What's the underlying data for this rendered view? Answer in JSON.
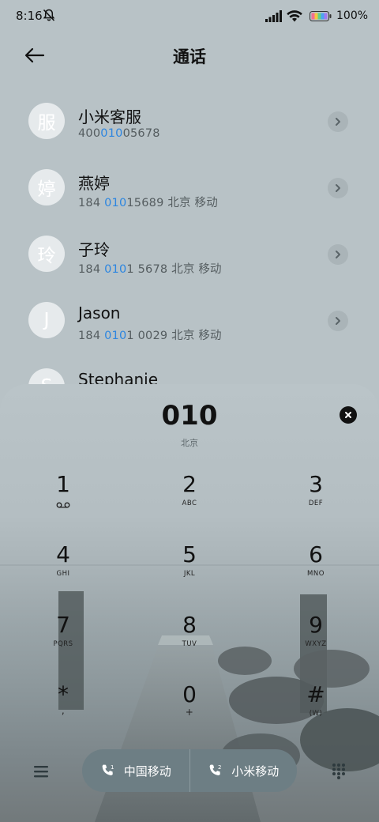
{
  "status": {
    "time": "8:16",
    "battery": "100%"
  },
  "header": {
    "title": "通话"
  },
  "contacts": [
    {
      "avatar": "服",
      "name": "小米客服",
      "number_pre": "400",
      "number_hl": "010",
      "number_post": "05678",
      "location": ""
    },
    {
      "avatar": "婷",
      "name": "燕婷",
      "number_pre": "184 ",
      "number_hl": "010",
      "number_post": "15689",
      "location": "北京 移动"
    },
    {
      "avatar": "玲",
      "name": "子玲",
      "number_pre": "184 ",
      "number_hl": "010",
      "number_post": "1 5678",
      "location": "北京 移动"
    },
    {
      "avatar": "J",
      "name": "Jason",
      "number_pre": "184 ",
      "number_hl": "010",
      "number_post": "1 0029",
      "location": "北京 移动"
    },
    {
      "avatar": "S",
      "name": "Stephanie",
      "number_pre": "",
      "number_hl": "",
      "number_post": "",
      "location": ""
    }
  ],
  "dialer": {
    "number": "010",
    "location": "北京",
    "keys": [
      {
        "digit": "1",
        "letters": ""
      },
      {
        "digit": "2",
        "letters": "ABC"
      },
      {
        "digit": "3",
        "letters": "DEF"
      },
      {
        "digit": "4",
        "letters": "GHI"
      },
      {
        "digit": "5",
        "letters": "JKL"
      },
      {
        "digit": "6",
        "letters": "MNO"
      },
      {
        "digit": "7",
        "letters": "PQRS"
      },
      {
        "digit": "8",
        "letters": "TUV"
      },
      {
        "digit": "9",
        "letters": "WXYZ"
      },
      {
        "digit": "*",
        "letters": ","
      },
      {
        "digit": "0",
        "letters": "+"
      },
      {
        "digit": "#",
        "letters": "(W)"
      }
    ],
    "sim1_label": "中国移动",
    "sim2_label": "小米移动"
  },
  "colors": {
    "highlight": "#2d86e0",
    "pill": "#6d7e84"
  }
}
